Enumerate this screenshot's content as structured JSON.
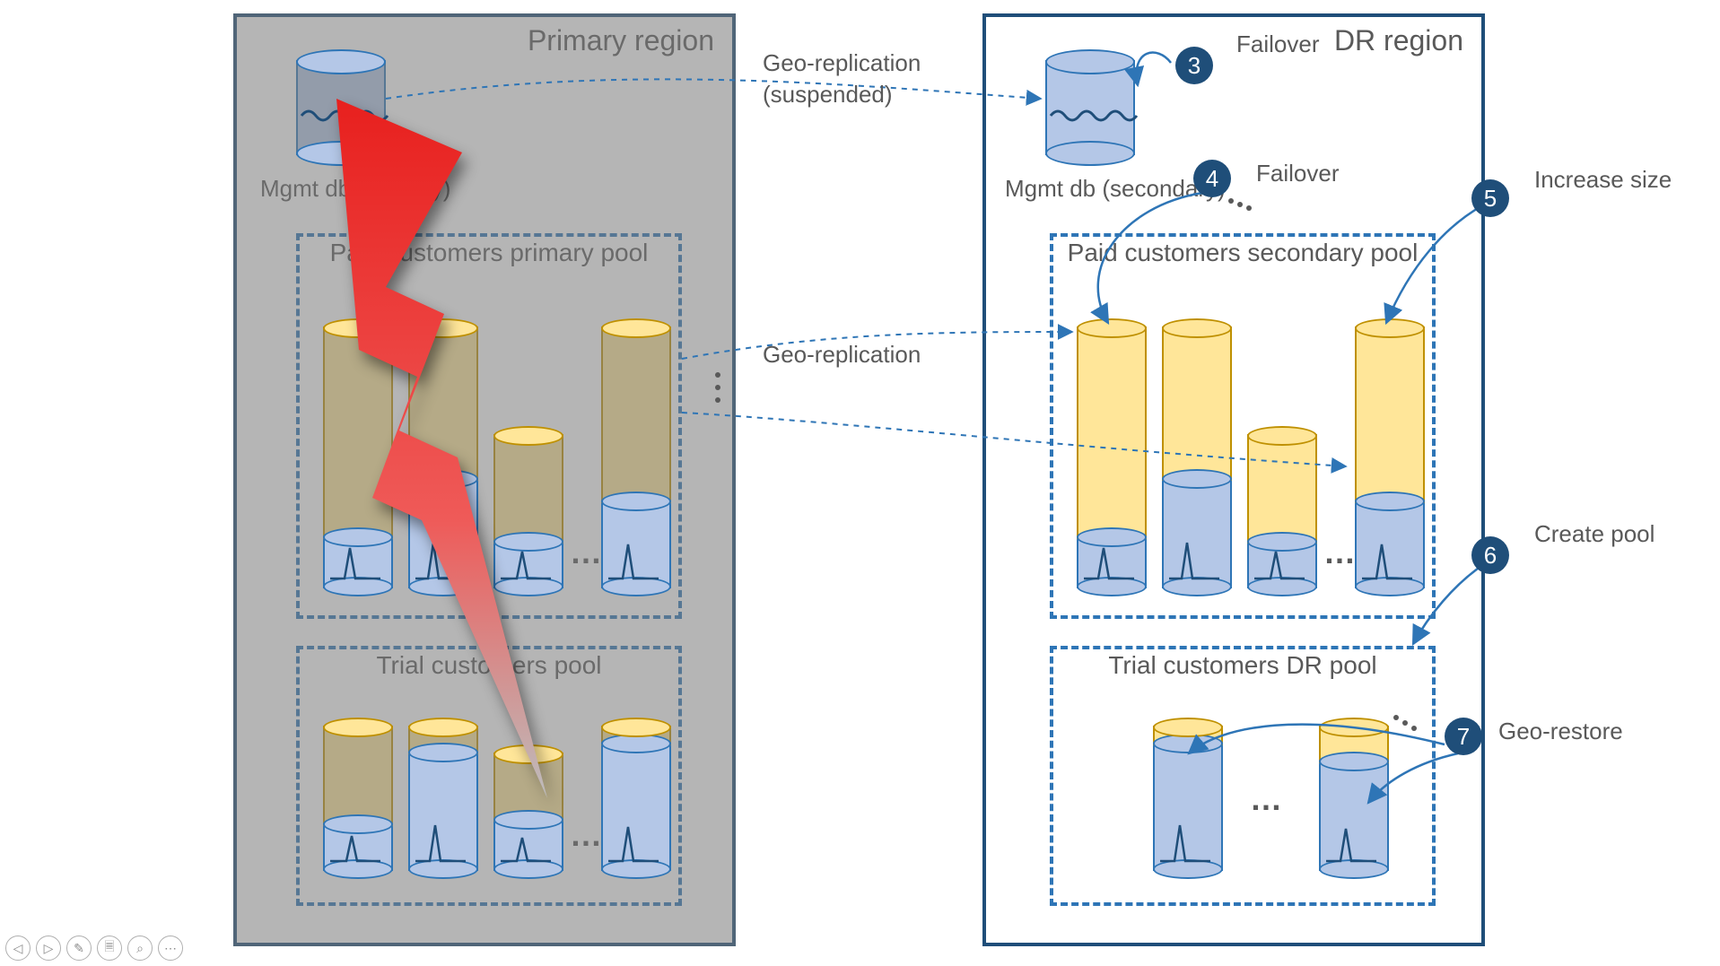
{
  "regions": {
    "primary": {
      "title": "Primary region",
      "disabled": true
    },
    "dr": {
      "title": "DR region"
    }
  },
  "dbs": {
    "primary_mgmt": "Mgmt db (primary)",
    "secondary_mgmt": "Mgmt db (secondary)"
  },
  "pools": {
    "primary_paid": "Paid customers primary pool",
    "primary_trial": "Trial customers pool",
    "dr_paid": "Paid customers secondary pool",
    "dr_trial": "Trial customers DR pool"
  },
  "connectors": {
    "geo_rep_suspended_l1": "Geo-replication",
    "geo_rep_suspended_l2": "(suspended)",
    "geo_rep": "Geo-replication"
  },
  "steps": {
    "s3": {
      "num": "3",
      "label": "Failover"
    },
    "s4": {
      "num": "4",
      "label": "Failover"
    },
    "s5": {
      "num": "5",
      "label": "Increase size"
    },
    "s6": {
      "num": "6",
      "label": "Create pool"
    },
    "s7": {
      "num": "7",
      "label": "Geo-restore"
    }
  },
  "ellipsis": "…",
  "colors": {
    "region_border": "#1f4e79",
    "pool_border": "#2e75b6",
    "tube_shell": "#ffe699",
    "tube_shell_border": "#bf9000",
    "tube_fill": "#b4c7e7",
    "tube_fill_border": "#2e75b6",
    "badge": "#1f4e79",
    "bolt_top": "#e8201e",
    "bolt_bottom": "#b7b7b7"
  },
  "toolbar": {
    "prev": "◁",
    "next": "▷",
    "pen": "✎",
    "subtitles": "🗏",
    "zoom": "⌕",
    "more": "⋯"
  }
}
